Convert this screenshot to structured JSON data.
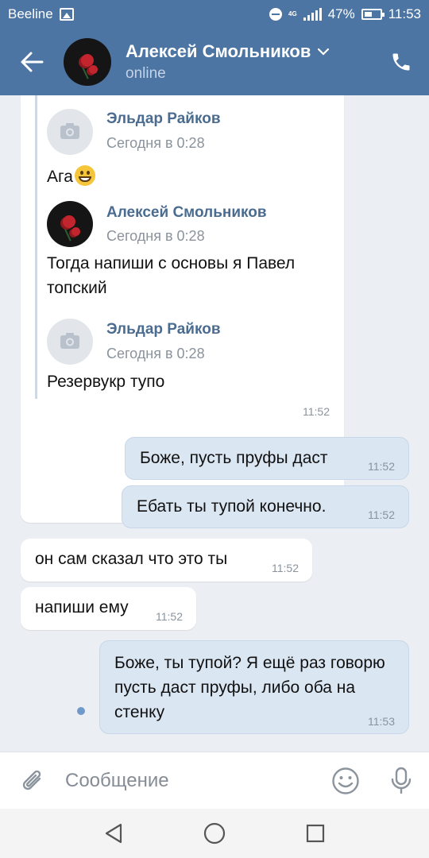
{
  "status_bar": {
    "carrier": "Beeline",
    "network_type": "4G",
    "battery": "47%",
    "time": "11:53"
  },
  "header": {
    "contact_name": "Алексей Смольников",
    "contact_status": "online"
  },
  "forwarded": [
    {
      "author": "Эльдар Райков",
      "date": "Сегодня в 0:28",
      "text": "Ага",
      "avatar": "camera-placeholder"
    },
    {
      "author": "Алексей Смольников",
      "date": "Сегодня в 0:28",
      "text": "Тогда напиши с основы я Павел топский",
      "avatar": "photo"
    },
    {
      "author": "Эльдар Райков",
      "date": "Сегодня в 0:28",
      "text": "Резервукр тупо",
      "avatar": "camera-placeholder"
    }
  ],
  "forward_time": "11:52",
  "messages": [
    {
      "direction": "out",
      "text": "Боже, пусть пруфы даст",
      "time": "11:52"
    },
    {
      "direction": "out",
      "text": "Ебать ты тупой конечно.",
      "time": "11:52"
    },
    {
      "direction": "in",
      "text": "он сам сказал что это ты",
      "time": "11:52"
    },
    {
      "direction": "in",
      "text": "напиши ему",
      "time": "11:52"
    },
    {
      "direction": "out",
      "text": "Боже, ты тупой? Я ещё раз говорю пусть даст пруфы, либо оба на стенку",
      "time": "11:53"
    }
  ],
  "compose": {
    "placeholder": "Сообщение"
  },
  "colors": {
    "header": "#4c75a3",
    "background": "#ebeef2",
    "outgoing_bubble": "#dbe6f3",
    "link_name": "#4a6c90"
  }
}
